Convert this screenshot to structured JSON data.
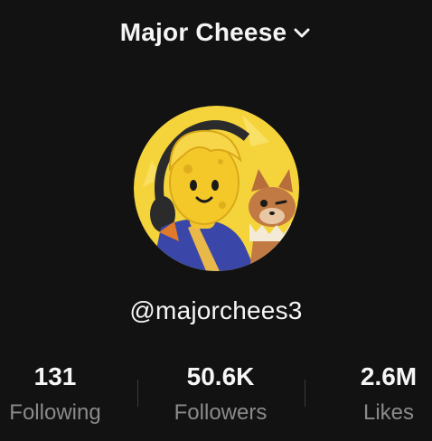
{
  "header": {
    "account_name": "Major Cheese",
    "chevron_icon": "chevron-down-icon"
  },
  "profile": {
    "avatar_icon": "profile-avatar",
    "username": "@majorchees3"
  },
  "stats": [
    {
      "value": "131",
      "label": "Following"
    },
    {
      "value": "50.6K",
      "label": "Followers"
    },
    {
      "value": "2.6M",
      "label": "Likes"
    }
  ],
  "colors": {
    "background": "#121212",
    "text": "#f6f6f6",
    "muted": "#8a8a8a",
    "avatar_bg": "#f5d43b"
  }
}
